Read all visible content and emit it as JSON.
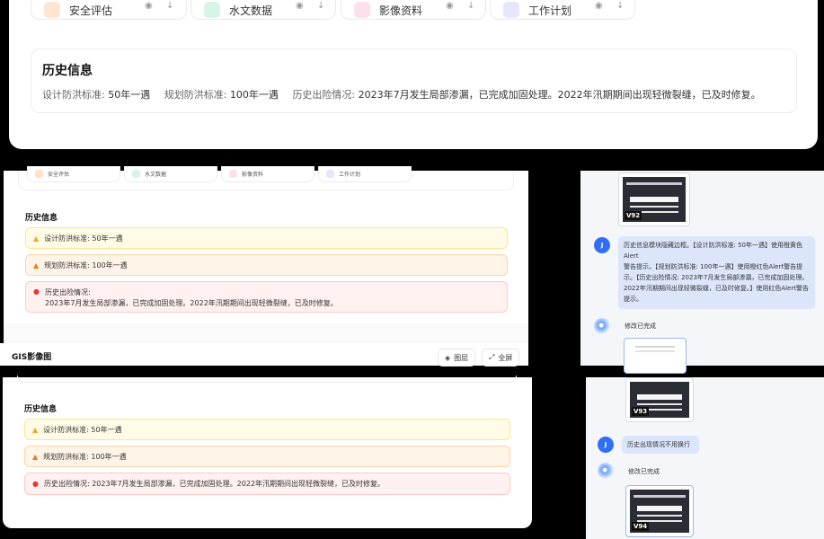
{
  "top": {
    "tabs": [
      {
        "label": "安全评估",
        "color": "#ff8a3d"
      },
      {
        "label": "水文数据",
        "color": "#2bb87a"
      },
      {
        "label": "影像资料",
        "color": "#ee4b8a"
      },
      {
        "label": "工作计划",
        "color": "#6b6bf0"
      }
    ],
    "history": {
      "title": "历史信息",
      "design_key": "设计防洪标准:",
      "design_val": "50年一遇",
      "plan_key": "规划防洪标准:",
      "plan_val": "100年一遇",
      "hist_key": "历史出险情况:",
      "hist_val": "2023年7月发生局部渗漏，已完成加固处理。2022年汛期期间出现轻微裂缝，已及时修复。"
    }
  },
  "midleft": {
    "tabs": [
      "安全评估",
      "水文数据",
      "影像资料",
      "工作计划"
    ],
    "section_title": "历史信息",
    "alert_design": "设计防洪标准:  50年一遇",
    "alert_plan": "规划防洪标准:  100年一遇",
    "alert_hist_title": "历史出险情况:",
    "alert_hist_body": "2023年7月发生局部渗漏，已完成加固处理。2022年汛期期间出现轻微裂缝，已及时修复。",
    "gis_title": "GIS影像图",
    "layers_btn": "图层",
    "fullscreen_btn": "全屏"
  },
  "botleft": {
    "section_title": "历史信息",
    "alert_design": "设计防洪标准:  50年一遇",
    "alert_plan": "规划防洪标准:  100年一遇",
    "alert_hist": "历史出险情况:  2023年7月发生局部渗漏，已完成加固处理。2022年汛期期间出现轻微裂缝，已及时修复。"
  },
  "chat1": {
    "thumb_version": "V92",
    "user_avatar": "J",
    "user_message": "历史信息模块隐藏边框。【设计防洪标准: 50年一遇】使用橙黄色Alert\n警告提示。【规划防洪标准: 100年一遇】使用橙红色Alert警告提示。【历史出险情况: 2023年7月发生局部渗漏，已完成加固处理。2022年汛期期间出现轻微裂缝，已及时修复。】使用红色Alert警告提示。",
    "bot_reply": "修改已完成"
  },
  "chat2": {
    "thumb_version_1": "V93",
    "user_avatar": "J",
    "user_message": "历史出现情况不用换行",
    "bot_reply": "修改已完成",
    "thumb_version_2": "V94"
  }
}
